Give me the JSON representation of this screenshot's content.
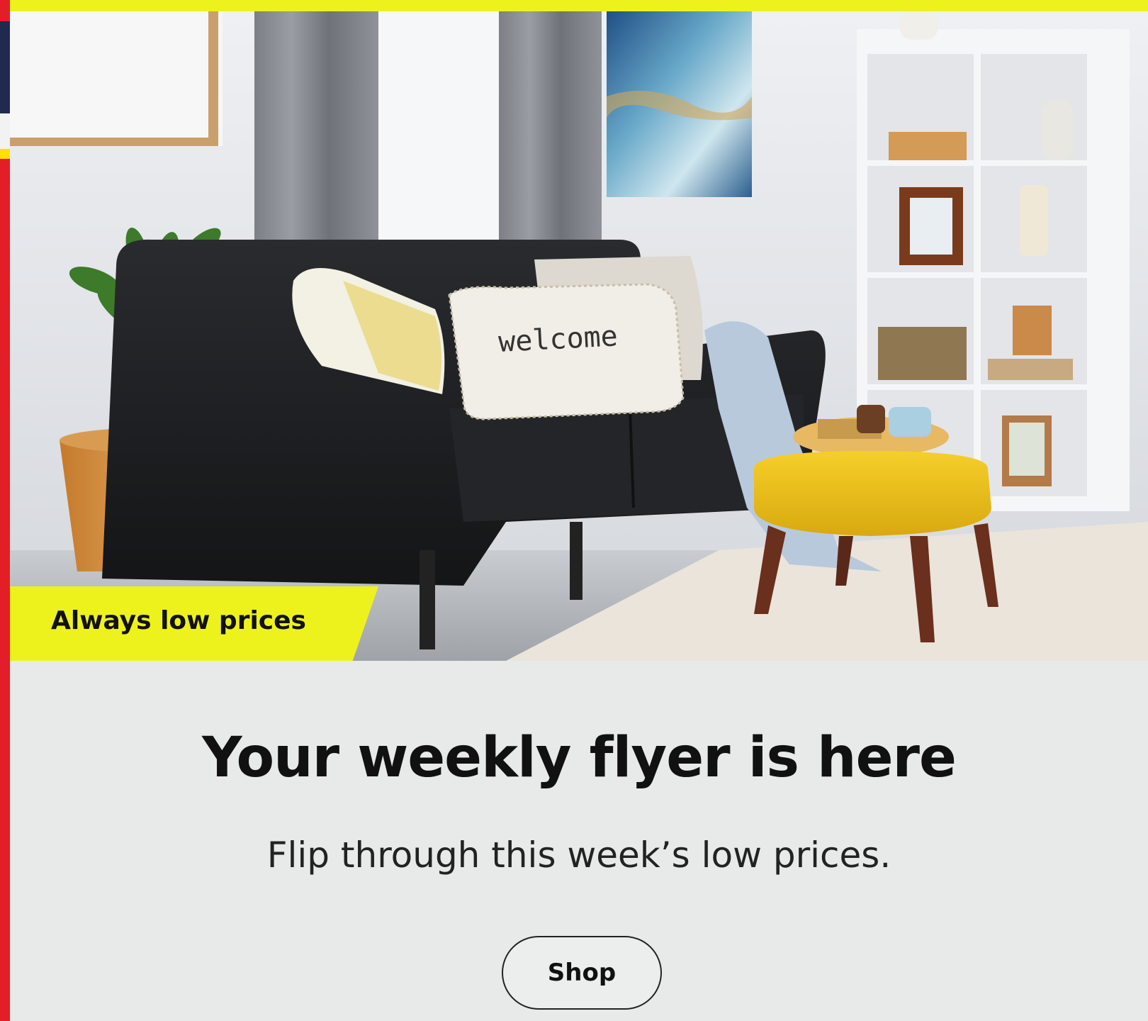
{
  "badge": {
    "label": "Always low prices"
  },
  "hero": {
    "image_description": "living-room-futon-scene",
    "pillow_text": "welcome"
  },
  "promo": {
    "headline": "Your weekly flyer is here",
    "subheadline": "Flip through this week’s low prices.",
    "shop_label": "Shop"
  },
  "colors": {
    "accent_yellow": "#eef21c",
    "brand_red": "#e41e26",
    "navy": "#1f2a4e",
    "background": "#e8eaea",
    "text": "#111111"
  }
}
